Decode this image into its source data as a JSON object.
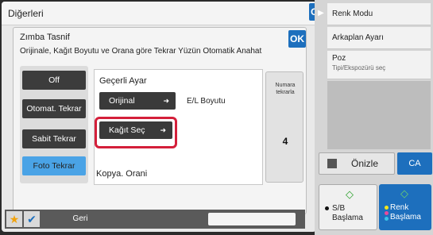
{
  "outer_dialog": {
    "title": "Diğerleri",
    "ok_label": "OK"
  },
  "right_panel": {
    "items": [
      {
        "label": "Renk Modu"
      },
      {
        "label": "Arkaplan Ayarı"
      },
      {
        "label": "Poz",
        "sublabel": "Tipi/Ekspozürü seç"
      }
    ],
    "preview_label": "Önizle",
    "ca_label": "CA",
    "start_bw": {
      "line1": "S/B",
      "line2": "Başlama"
    },
    "start_color": {
      "line1": "Renk",
      "line2": "Başlama"
    }
  },
  "inner_dialog": {
    "title": "Zımba Tasnif",
    "description": "Orijinale, Kağıt Boyutu ve Orana göre Tekrar Yüzün Otomatik Anahat",
    "ok_label": "OK",
    "modes": [
      {
        "label": "Off",
        "active": false
      },
      {
        "label": "Otomat. Tekrar",
        "active": false
      },
      {
        "label": "Sabit Tekrar",
        "active": false
      },
      {
        "label": "Foto Tekrar",
        "active": true
      }
    ],
    "current_settings_label": "Geçerli Ayar",
    "original_button": "Orijinal",
    "original_value": "E/L Boyutu",
    "paper_button": "Kağıt Seç",
    "copy_ratio_label": "Kopya. Orani",
    "count_label": "Numara tekrarla",
    "count_value": "4"
  },
  "bottom_bar": {
    "back_label": "Geri"
  },
  "colors": {
    "accent_blue": "#1d6fbd",
    "active_mode": "#4aa3e6",
    "highlight_red": "#d41f3a"
  }
}
